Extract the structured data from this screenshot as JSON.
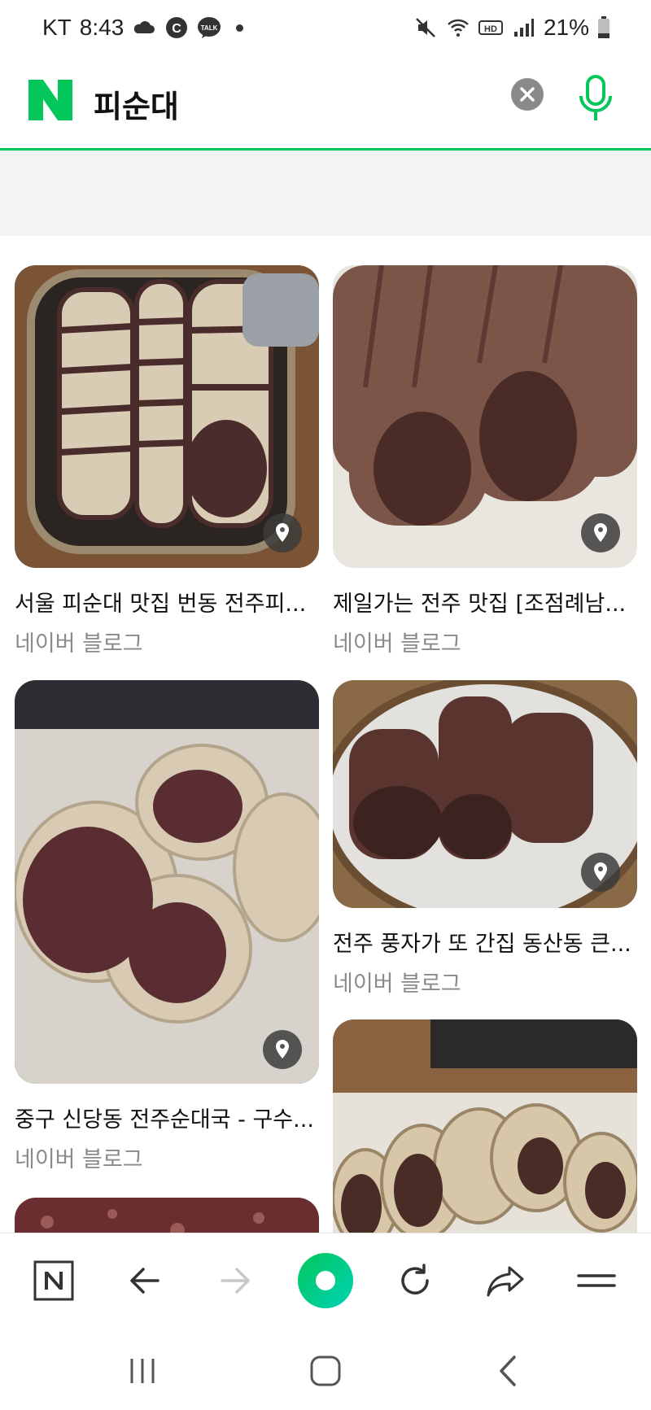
{
  "status_bar": {
    "carrier": "KT",
    "time": "8:43",
    "battery": "21%",
    "talk_badge": "TALK",
    "c_badge": "C",
    "hd_badge": "HD"
  },
  "search": {
    "query": "피순대"
  },
  "results": [
    {
      "title": "서울 피순대 맛집 번동 전주피...",
      "source": "네이버 블로그"
    },
    {
      "title": "제일가는 전주 맛집 [조점례남...",
      "source": "네이버 블로그"
    },
    {
      "title": "중구 신당동 전주순대국 - 구수...",
      "source": "네이버 블로그"
    },
    {
      "title": "전주 풍자가 또 간집 동산동 큰...",
      "source": "네이버 블로그"
    }
  ],
  "icons": {
    "naver_logo": "naver-n-logo",
    "clear": "close-icon",
    "mic": "microphone-icon",
    "pin": "location-pin-icon"
  },
  "colors": {
    "accent": "#03c75a",
    "header_border": "#03c75a",
    "source_text": "#8a8a8a"
  }
}
